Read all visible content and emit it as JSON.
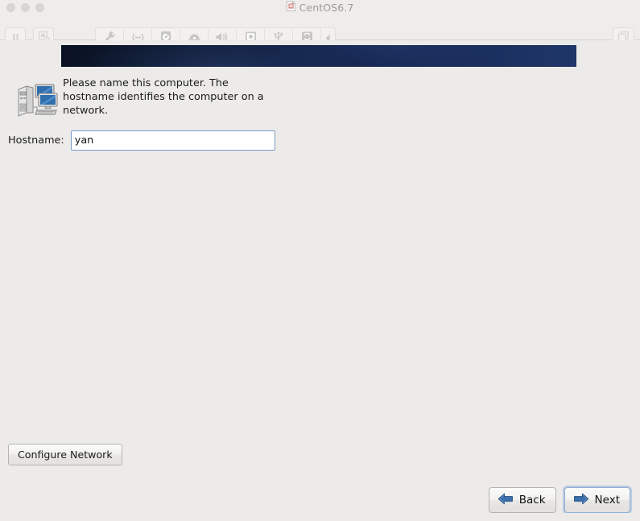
{
  "window": {
    "title": "CentOS6.7",
    "title_icon": "document-icon",
    "traffic_lights": [
      "close-button",
      "minimize-button",
      "maximize-button"
    ]
  },
  "vm_toolbar": {
    "left_buttons": [
      {
        "name": "pause-button",
        "icon": "pause-icon"
      },
      {
        "name": "snapshot-button",
        "icon": "snapshot-clock-icon"
      }
    ],
    "device_buttons": [
      {
        "name": "settings-button",
        "icon": "wrench-icon"
      },
      {
        "name": "network-button",
        "icon": "network-icon"
      },
      {
        "name": "hard-disk-button",
        "icon": "hard-disk-icon"
      },
      {
        "name": "optical-drive-button",
        "icon": "cd-drive-icon"
      },
      {
        "name": "sound-button",
        "icon": "speaker-icon"
      },
      {
        "name": "camera-button",
        "icon": "camera-icon"
      },
      {
        "name": "usb-button",
        "icon": "usb-icon"
      },
      {
        "name": "shared-folders-button",
        "icon": "sync-icon"
      },
      {
        "name": "collapse-toolbar-button",
        "icon": "chevron-left-icon"
      }
    ],
    "right_buttons": [
      {
        "name": "unity-view-button",
        "icon": "windows-stack-icon"
      }
    ]
  },
  "installer": {
    "banner_colors": {
      "left": "#0a1222",
      "right": "#1e3668"
    },
    "icon": "network-computers-icon",
    "description": "Please name this computer.  The\nhostname identifies the computer on a\nnetwork.",
    "hostname": {
      "label": "Hostname:",
      "value": "yan",
      "placeholder": ""
    },
    "configure_network_label": "Configure Network",
    "nav": {
      "back_label": "Back",
      "next_label": "Next",
      "back_icon": "arrow-left-icon",
      "next_icon": "arrow-right-icon",
      "focused": "next"
    }
  }
}
